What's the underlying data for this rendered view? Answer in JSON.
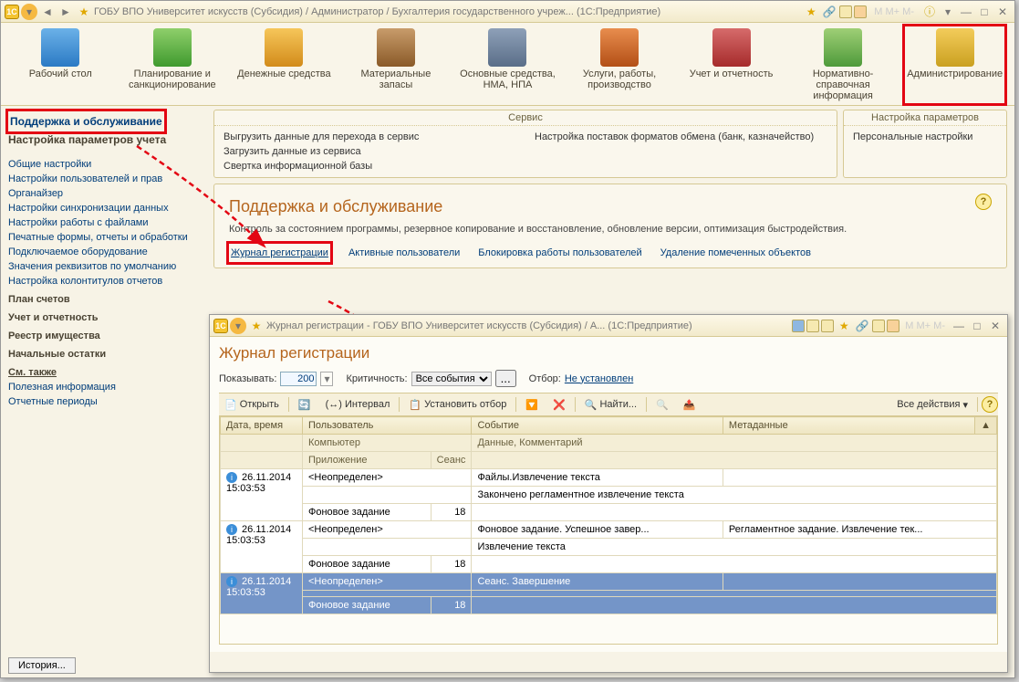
{
  "main_title": "ГОБУ ВПО Университет искусств (Субсидия) / Администратор / Бухгалтерия государственного учреж... (1С:Предприятие)",
  "toolbar": [
    {
      "label": "Рабочий стол",
      "ico": "ico-desk"
    },
    {
      "label": "Планирование и санкционирование",
      "ico": "ico-plan"
    },
    {
      "label": "Денежные средства",
      "ico": "ico-money"
    },
    {
      "label": "Материальные запасы",
      "ico": "ico-stock"
    },
    {
      "label": "Основные средства, НМА, НПА",
      "ico": "ico-assets"
    },
    {
      "label": "Услуги, работы, производство",
      "ico": "ico-svc"
    },
    {
      "label": "Учет и отчетность",
      "ico": "ico-acc"
    },
    {
      "label": "Нормативно-справочная информация",
      "ico": "ico-ref"
    },
    {
      "label": "Администрирование",
      "ico": "ico-admin",
      "hl": true
    }
  ],
  "sidebar": {
    "hl": "Поддержка и обслуживание",
    "sub_hl": "Настройка параметров учета",
    "items": [
      "Общие настройки",
      "Настройки пользователей и прав",
      "Органайзер",
      "Настройки синхронизации данных",
      "Настройки работы с файлами",
      "Печатные формы, отчеты и обработки",
      "Подключаемое оборудование",
      "Значения реквизитов по умолчанию",
      "Настройка колонтитулов отчетов"
    ],
    "sections": [
      "План счетов",
      "Учет и отчетность",
      "Реестр имущества",
      "Начальные остатки"
    ],
    "see_also_label": "См. также",
    "see_also": [
      "Полезная информация",
      "Отчетные периоды"
    ]
  },
  "service_box": {
    "title": "Сервис",
    "col1": [
      "Выгрузить данные для перехода в сервис",
      "Загрузить данные из сервиса",
      "Свертка информационной базы"
    ],
    "col2": [
      "Настройка поставок форматов обмена (банк, казначейство)"
    ]
  },
  "params_box": {
    "title": "Настройка параметров",
    "items": [
      "Персональные настройки"
    ]
  },
  "panel": {
    "title": "Поддержка и обслуживание",
    "desc": "Контроль за состоянием программы, резервное копирование и восстановление, обновление версии, оптимизация быстродействия.",
    "links": [
      "Журнал регистрации",
      "Активные пользователи",
      "Блокировка работы пользователей",
      "Удаление помеченных объектов"
    ]
  },
  "history_btn": "История...",
  "journal": {
    "title": "Журнал регистрации - ГОБУ ВПО Университет искусств (Субсидия) / А...  (1С:Предприятие)",
    "heading": "Журнал регистрации",
    "show_label": "Показывать:",
    "show_value": "200",
    "crit_label": "Критичность:",
    "crit_value": "Все события",
    "filter_label": "Отбор:",
    "filter_value": "Не установлен",
    "actions": {
      "open": "Открыть",
      "interval": "(↔) Интервал",
      "set_filter": "Установить отбор",
      "find": "Найти...",
      "all": "Все действия"
    },
    "columns": {
      "dt": "Дата, время",
      "user": "Пользователь",
      "event": "Событие",
      "meta": "Метаданные",
      "comp": "Компьютер",
      "data": "Данные, Комментарий",
      "app": "Приложение",
      "sess": "Сеанс"
    },
    "rows": [
      {
        "dt": "26.11.2014 15:03:53",
        "user": "<Неопределен>",
        "event": "Файлы.Извлечение текста",
        "meta": "",
        "data": "Закончено регламентное извлечение текста",
        "app": "Фоновое задание",
        "sess": "18"
      },
      {
        "dt": "26.11.2014 15:03:53",
        "user": "<Неопределен>",
        "event": "Фоновое задание. Успешное завер...",
        "meta": "Регламентное задание. Извлечение тек...",
        "data": "Извлечение текста",
        "app": "Фоновое задание",
        "sess": "18"
      },
      {
        "dt": "26.11.2014 15:03:53",
        "user": "<Неопределен>",
        "event": "Сеанс. Завершение",
        "meta": "",
        "data": "",
        "app": "Фоновое задание",
        "sess": "18",
        "sel": true
      }
    ]
  }
}
